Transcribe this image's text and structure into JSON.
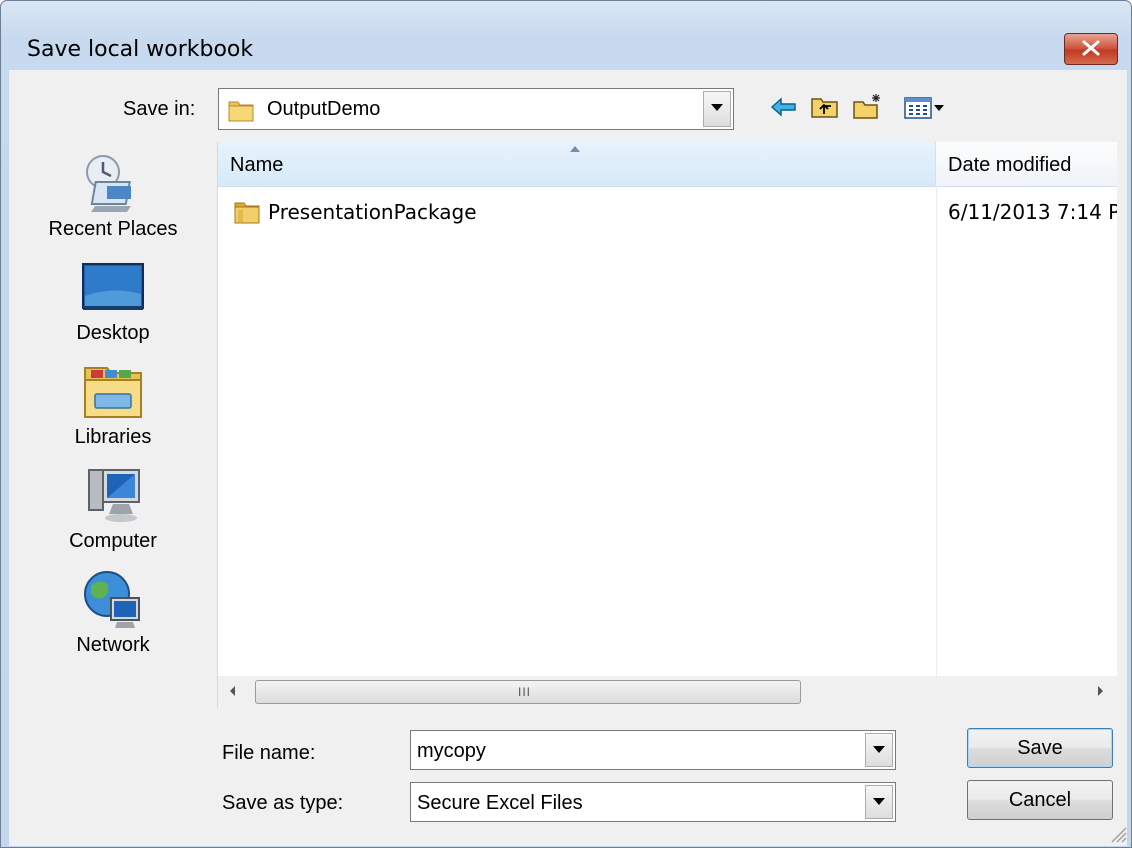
{
  "window": {
    "title": "Save local workbook"
  },
  "toolbar": {
    "save_in_label": "Save in:",
    "save_in_value": "OutputDemo",
    "icons": [
      "back-icon",
      "up-folder-icon",
      "new-folder-icon",
      "view-menu-icon"
    ]
  },
  "places": [
    {
      "label": "Recent Places",
      "icon": "recent-places-icon"
    },
    {
      "label": "Desktop",
      "icon": "desktop-icon"
    },
    {
      "label": "Libraries",
      "icon": "libraries-icon"
    },
    {
      "label": "Computer",
      "icon": "computer-icon"
    },
    {
      "label": "Network",
      "icon": "network-icon"
    }
  ],
  "list": {
    "columns": [
      "Name",
      "Date modified"
    ],
    "rows": [
      {
        "name": "PresentationPackage",
        "date": "6/11/2013 7:14 P",
        "icon": "folder-icon"
      }
    ],
    "scroll_grip": "III"
  },
  "form": {
    "file_name_label": "File name:",
    "file_name_value": "mycopy",
    "save_as_type_label": "Save as type:",
    "save_as_type_value": "Secure Excel Files"
  },
  "buttons": {
    "save": "Save",
    "cancel": "Cancel"
  },
  "colors": {
    "titlebar": "#c7d9ee",
    "close_button": "#c13a22",
    "dialog_bg": "#f0f0f0",
    "header_selected": "#d6e9f8"
  }
}
